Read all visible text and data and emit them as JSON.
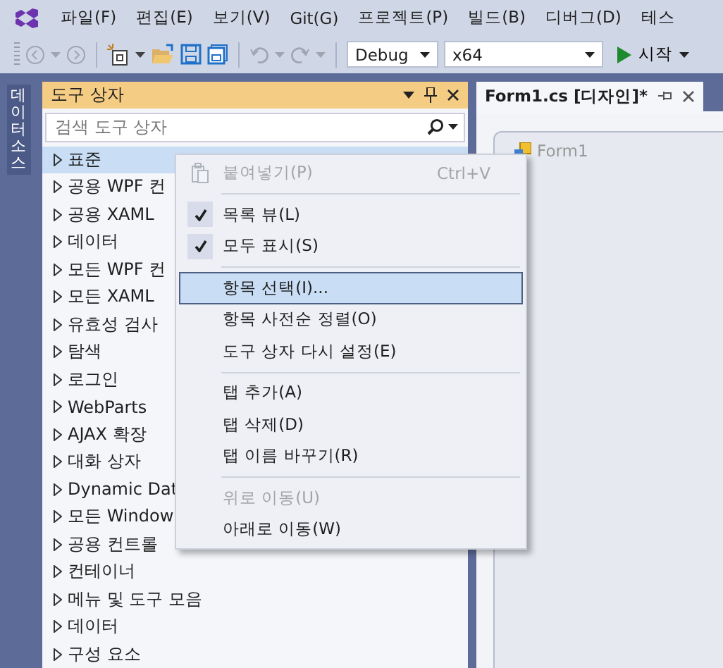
{
  "menu_bar": [
    "파일(F)",
    "편집(E)",
    "보기(V)",
    "Git(G)",
    "프로젝트(P)",
    "빌드(B)",
    "디버그(D)",
    "테스"
  ],
  "toolbar": {
    "configuration": "Debug",
    "platform": "x64",
    "start_label": "시작"
  },
  "side_tab": {
    "label": "데이터 소스"
  },
  "toolbox": {
    "title": "도구 상자",
    "search": {
      "placeholder": "검색 도구 상자"
    },
    "items": [
      {
        "label": "표준",
        "selected": true
      },
      {
        "label": "공용 WPF 컨",
        "selected": false
      },
      {
        "label": "공용 XAML",
        "selected": false
      },
      {
        "label": "데이터",
        "selected": false
      },
      {
        "label": "모든 WPF 컨",
        "selected": false
      },
      {
        "label": "모든 XAML",
        "selected": false
      },
      {
        "label": "유효성 검사",
        "selected": false
      },
      {
        "label": "탐색",
        "selected": false
      },
      {
        "label": "로그인",
        "selected": false
      },
      {
        "label": "WebParts",
        "selected": false
      },
      {
        "label": "AJAX 확장",
        "selected": false
      },
      {
        "label": "대화 상자",
        "selected": false
      },
      {
        "label": "Dynamic Dat",
        "selected": false
      },
      {
        "label": "모든 Window",
        "selected": false
      },
      {
        "label": "공용 컨트롤",
        "selected": false
      },
      {
        "label": "컨테이너",
        "selected": false
      },
      {
        "label": "메뉴 및 도구 모음",
        "selected": false
      },
      {
        "label": "데이터",
        "selected": false
      },
      {
        "label": "구성 요소",
        "selected": false
      }
    ]
  },
  "context_menu": [
    {
      "kind": "pasteitem",
      "label": "붙여넣기(P)",
      "shortcut": "Ctrl+V",
      "checked": false,
      "disabled": true,
      "selected": false
    },
    {
      "kind": "separator"
    },
    {
      "kind": "item",
      "label": "목록 뷰(L)",
      "checked": true,
      "disabled": false,
      "selected": false
    },
    {
      "kind": "item",
      "label": "모두 표시(S)",
      "checked": true,
      "disabled": false,
      "selected": false
    },
    {
      "kind": "separator"
    },
    {
      "kind": "item",
      "label": "항목 선택(I)...",
      "checked": false,
      "disabled": false,
      "selected": true
    },
    {
      "kind": "item",
      "label": "항목 사전순 정렬(O)",
      "checked": false,
      "disabled": false,
      "selected": false
    },
    {
      "kind": "item",
      "label": "도구 상자 다시 설정(E)",
      "checked": false,
      "disabled": false,
      "selected": false
    },
    {
      "kind": "separator"
    },
    {
      "kind": "item",
      "label": "탭 추가(A)",
      "checked": false,
      "disabled": false,
      "selected": false
    },
    {
      "kind": "item",
      "label": "탭 삭제(D)",
      "checked": false,
      "disabled": false,
      "selected": false
    },
    {
      "kind": "item",
      "label": "탭 이름 바꾸기(R)",
      "checked": false,
      "disabled": false,
      "selected": false
    },
    {
      "kind": "separator"
    },
    {
      "kind": "item",
      "label": "위로 이동(U)",
      "checked": false,
      "disabled": true,
      "selected": false
    },
    {
      "kind": "item",
      "label": "아래로 이동(W)",
      "checked": false,
      "disabled": false,
      "selected": false
    }
  ],
  "document_tab": {
    "title": "Form1.cs [디자인]*",
    "selected": true
  },
  "designer": {
    "form_title": "Form1"
  }
}
